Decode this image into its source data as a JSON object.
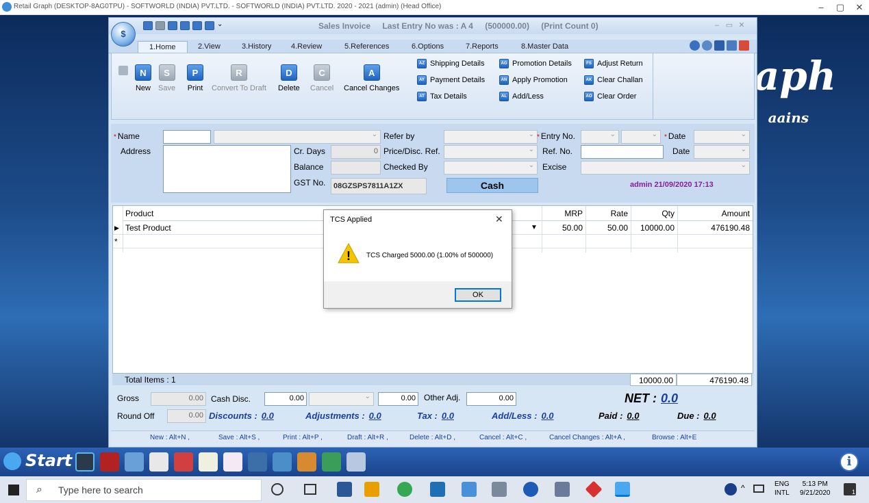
{
  "outer_window": {
    "title": "Retail Graph (DESKTOP-8AG0TPU) - SOFTWORLD (INDIA) PVT.LTD. - SOFTWORLD (INDIA) PVT.LTD.  2020 - 2021 (admin) (Head Office)",
    "minimize": "–",
    "maximize": "▢",
    "close": "✕"
  },
  "desktop": {
    "logo_text": "aph",
    "logo_sub": "aains"
  },
  "window": {
    "title": "Sales Invoice",
    "last_entry": "Last Entry No was : A 4",
    "amount": "(500000.00)",
    "print_count": "(Print Count 0)",
    "orb_label": "$",
    "qat_dropdown": "⌄",
    "minimize": "–",
    "restore": "▭",
    "close": "✕"
  },
  "tabs": [
    "1.Home",
    "2.View",
    "3.History",
    "4.Review",
    "5.References",
    "6.Options",
    "7.Reports",
    "8.Master Data"
  ],
  "ribbon": {
    "new": "New",
    "save": "Save",
    "print": "Print",
    "convert": "Convert To Draft",
    "delete": "Delete",
    "cancel": "Cancel",
    "cancel_changes": "Cancel Changes",
    "shipping": "Shipping Details",
    "payment": "Payment Details",
    "tax": "Tax Details",
    "promotion_details": "Promotion Details",
    "apply_promotion": "Apply Promotion",
    "add_less": "Add/Less",
    "adjust_return": "Adjust Return",
    "clear_challan": "Clear Challan",
    "clear_order": "Clear Order"
  },
  "ribbon_icon_letters": {
    "new": "N",
    "save": "S",
    "print": "P",
    "convert": "R",
    "delete": "D",
    "cancel": "C",
    "cancel_changes": "A",
    "shipping": "AZ",
    "payment": "AY",
    "tax": "AT",
    "promotion_details": "AG",
    "apply_promotion": "AN",
    "add_less": "AL",
    "adjust_return": "FS",
    "clear_challan": "AK",
    "clear_order": "AO"
  },
  "form": {
    "name_label": "Name",
    "address_label": "Address",
    "cr_days_label": "Cr. Days",
    "cr_days_value": "0",
    "balance_label": "Balance",
    "gst_label": "GST No.",
    "gst_value": "08GZSPS7811A1ZX",
    "refer_by_label": "Refer by",
    "price_disc_label": "Price/Disc. Ref.",
    "checked_by_label": "Checked By",
    "entry_no_label": "Entry No.",
    "ref_no_label": "Ref. No.",
    "excise_label": "Excise",
    "date_label": "Date",
    "date2_label": "Date",
    "payment_mode": "Cash",
    "user_stamp": "admin 21/09/2020 17:13"
  },
  "grid": {
    "columns": [
      "Product",
      "MRP",
      "Rate",
      "Qty",
      "Amount"
    ],
    "rows": [
      {
        "product": "Test Product",
        "mrp": "50.00",
        "rate": "50.00",
        "qty": "10000.00",
        "amount": "476190.48"
      }
    ],
    "new_row_marker": "*",
    "row_marker": "▶",
    "footer_label": "Total Items : 1",
    "footer_qty": "10000.00",
    "footer_amount": "476190.48"
  },
  "totals": {
    "gross_label": "Gross",
    "gross_value": "0.00",
    "cash_disc_label": "Cash Disc.",
    "cash_disc_value": "0.00",
    "cash_disc_pct": "0.00",
    "other_adj_label": "Other Adj.",
    "other_adj_value": "0.00",
    "round_off_label": "Round Off",
    "round_off_value": "0.00",
    "discounts_label": "Discounts :",
    "discounts_value": "0.0",
    "adjustments_label": "Adjustments :",
    "adjustments_value": "0.0",
    "tax_label": "Tax :",
    "tax_value": "0.0",
    "addless_label": "Add/Less :",
    "addless_value": "0.0",
    "net_label": "NET :",
    "net_value": "0.0",
    "paid_label": "Paid :",
    "paid_value": "0.0",
    "due_label": "Due :",
    "due_value": "0.0"
  },
  "shortcuts": [
    "New : Alt+N ,",
    "Save : Alt+S ,",
    "Print : Alt+P ,",
    "Draft : Alt+R ,",
    "Delete : Alt+D ,",
    "Cancel : Alt+C ,",
    "Cancel Changes : Alt+A ,",
    "Browse : Alt+E"
  ],
  "dialog": {
    "title": "TCS Applied",
    "message": "TCS Charged 5000.00 (1.00% of 500000)",
    "ok": "OK",
    "close": "✕",
    "warn_glyph": "!"
  },
  "app_taskbar": {
    "start_label": "Start",
    "info_glyph": "i"
  },
  "windows_taskbar": {
    "search_placeholder": "Type here to search",
    "lang_line1": "ENG",
    "lang_line2": "INTL",
    "time": "5:13 PM",
    "date": "9/21/2020",
    "notif_count": "1"
  },
  "colors": {
    "accent": "#1f63c1",
    "dialog_warn": "#f5c400",
    "stamp": "#8a1c9b",
    "link_blue": "#1a3fa0"
  }
}
